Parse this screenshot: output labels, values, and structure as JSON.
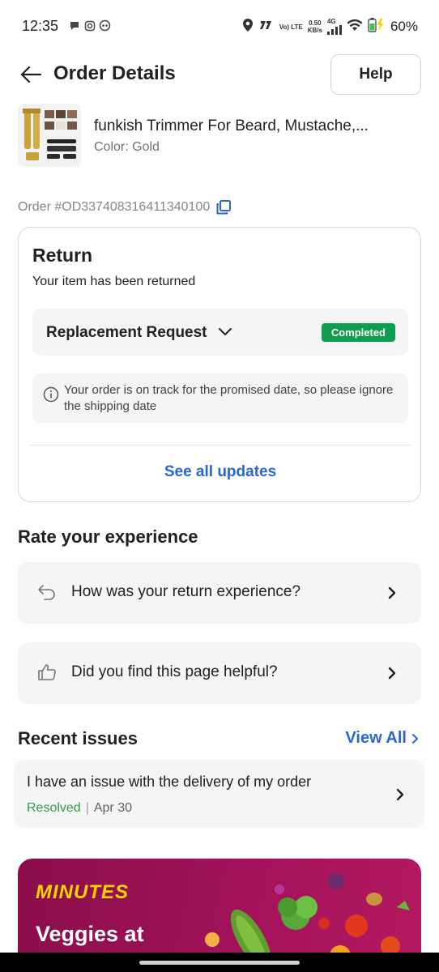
{
  "status_bar": {
    "time": "12:35",
    "network_label": "Vo) LTE",
    "speed_value": "0.50",
    "speed_unit": "KB/s",
    "cell_type": "4G",
    "battery_percent": "60%"
  },
  "header": {
    "title": "Order Details",
    "help_label": "Help"
  },
  "product": {
    "name": "funkish Trimmer For Beard, Mustache,...",
    "variant": "Color: Gold"
  },
  "order": {
    "id_label": "Order #OD337408316411340100"
  },
  "return_card": {
    "title": "Return",
    "subtitle": "Your item has been returned",
    "request_label": "Replacement Request",
    "status": "Completed",
    "info_text": "Your order is on track for the promised date, so please ignore the shipping date",
    "see_all_label": "See all updates"
  },
  "rate": {
    "title": "Rate your experience",
    "items": [
      {
        "label": "How was your return experience?",
        "icon": "return-arrow-icon"
      },
      {
        "label": "Did you find this page helpful?",
        "icon": "thumbs-up-icon"
      }
    ]
  },
  "issues": {
    "title": "Recent issues",
    "view_all_label": "View All",
    "items": [
      {
        "text": "I have an issue with the delivery of my order",
        "status": "Resolved",
        "separator": "|",
        "date": "Apr 30"
      }
    ]
  },
  "banner": {
    "brand": "MINUTES",
    "title": "Veggies at"
  },
  "colors": {
    "link_blue": "#2a65d4",
    "success_green": "#0f9d4f",
    "resolved_green": "#2e9e47",
    "banner_magenta": "#a2125b",
    "brand_yellow": "#ffd400"
  }
}
